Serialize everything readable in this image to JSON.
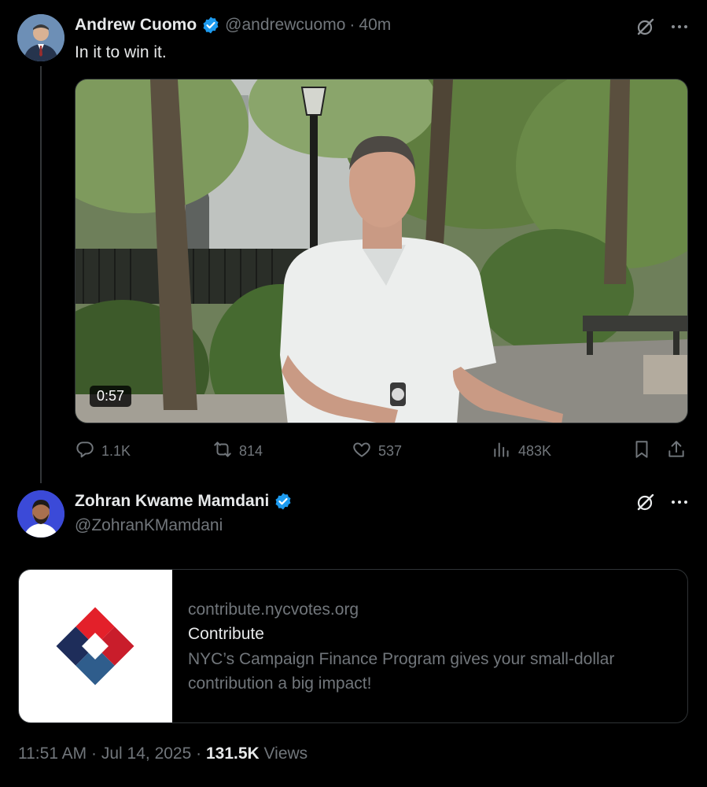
{
  "tweet1": {
    "display_name": "Andrew Cuomo",
    "handle": "@andrewcuomo",
    "separator": "·",
    "time": "40m",
    "text": "In it to win it.",
    "video_duration": "0:57",
    "actions": {
      "replies": "1.1K",
      "reposts": "814",
      "likes": "537",
      "views": "483K"
    }
  },
  "tweet2": {
    "display_name": "Zohran Kwame Mamdani",
    "handle": "@ZohranKMamdani",
    "card": {
      "domain": "contribute.nycvotes.org",
      "title": "Contribute",
      "description": "NYC’s Campaign Finance Program gives your small-dollar contribution a big impact!"
    },
    "meta": {
      "time": "11:51 AM",
      "sep1": "·",
      "date": "Jul 14, 2025",
      "sep2": "·",
      "views_count": "131.5K",
      "views_label": "Views"
    }
  },
  "colors": {
    "background": "#000000",
    "primary_text": "#e7e9ea",
    "secondary_text": "#71767b",
    "verified_blue": "#1d9bf0",
    "border": "#2f3336"
  },
  "icons": [
    "verified-badge-icon",
    "grok-icon",
    "more-icon",
    "reply-icon",
    "repost-icon",
    "like-icon",
    "views-icon",
    "bookmark-icon",
    "share-icon"
  ]
}
